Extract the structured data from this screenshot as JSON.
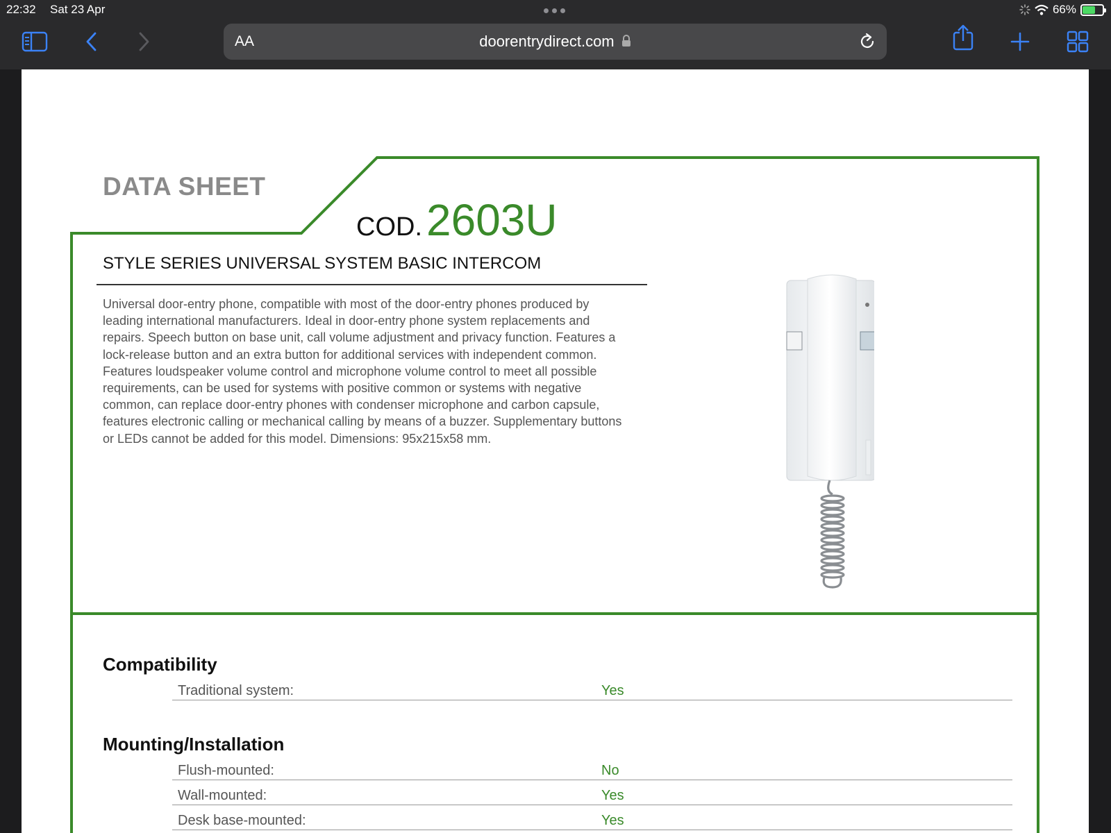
{
  "status_bar": {
    "time": "22:32",
    "date": "Sat 23 Apr",
    "battery_percent": "66%",
    "battery_level": 0.66
  },
  "browser": {
    "text_size_label": "AA",
    "url": "doorentrydirect.com",
    "icons": [
      "sidebar-icon",
      "back-icon",
      "forward-icon",
      "lock-icon",
      "reload-icon",
      "share-icon",
      "plus-icon",
      "tabs-icon"
    ]
  },
  "document": {
    "heading": "DATA SHEET",
    "code_prefix": "COD.",
    "code_value": "2603U",
    "product_title": "STYLE SERIES UNIVERSAL SYSTEM BASIC INTERCOM",
    "description": "Universal door-entry phone, compatible with most of the door-entry phones produced by leading international manufacturers. Ideal in door-entry phone system replacements and repairs. Speech button on base unit, call volume adjustment and privacy function. Features a lock-release button and an extra button for additional services with independent common. Features loudspeaker volume control and microphone volume control to meet all possible requirements, can be used for systems with positive common or systems with negative common, can replace door-entry phones with condenser microphone and carbon capsule, features electronic calling or mechanical calling by means of a buzzer. Supplementary buttons or LEDs cannot be added for this model. Dimensions: 95x215x58 mm.",
    "accent_color": "#3a8a2a",
    "sections": [
      {
        "title": "Compatibility",
        "rows": [
          {
            "label": "Traditional system:",
            "value": "Yes"
          }
        ]
      },
      {
        "title": "Mounting/Installation",
        "rows": [
          {
            "label": "Flush-mounted:",
            "value": "No"
          },
          {
            "label": "Wall-mounted:",
            "value": "Yes"
          },
          {
            "label": "Desk base-mounted:",
            "value": "Yes"
          }
        ]
      }
    ]
  }
}
